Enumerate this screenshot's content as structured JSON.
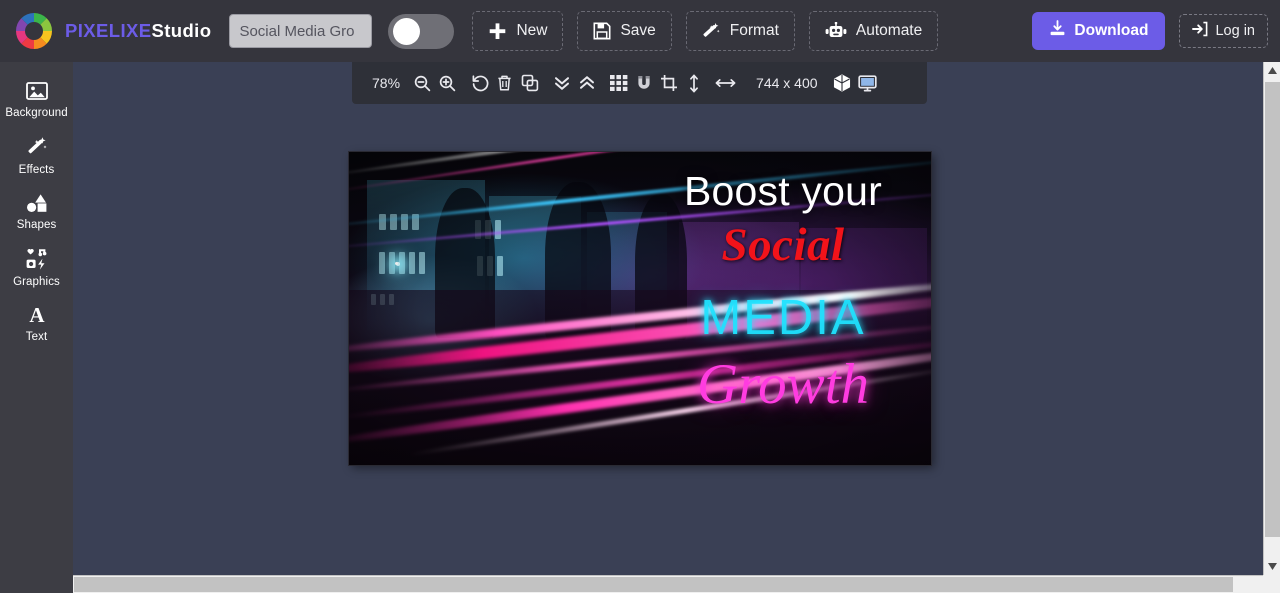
{
  "app": {
    "brand_primary": "PIXELIXE",
    "brand_secondary": "Studio",
    "accent_color": "#6c5ce7",
    "topbar_bg": "#35353d",
    "sidebar_bg": "#3d3d44",
    "workspace_bg": "#3a4055"
  },
  "header": {
    "project_title_value": "Social Media Gro",
    "project_title_placeholder": "Social Media Gro",
    "toggle_state": "off",
    "buttons": [
      {
        "label": "New",
        "icon": "plus-icon"
      },
      {
        "label": "Save",
        "icon": "floppy-disk-icon"
      },
      {
        "label": "Format",
        "icon": "magic-wand-icon"
      },
      {
        "label": "Automate",
        "icon": "robot-icon"
      }
    ],
    "download_label": "Download",
    "download_icon": "download-icon",
    "login_label": "Log in",
    "login_icon": "sign-in-icon"
  },
  "sidebar": {
    "items": [
      {
        "label": "Background",
        "icon": "image-icon"
      },
      {
        "label": "Effects",
        "icon": "magic-wand-icon"
      },
      {
        "label": "Shapes",
        "icon": "shapes-icon"
      },
      {
        "label": "Graphics",
        "icon": "graphics-grid-icon"
      },
      {
        "label": "Text",
        "icon": "letter-a-icon"
      }
    ]
  },
  "canvas_toolbar": {
    "zoom_level": "78%",
    "dimensions": "744 x 400",
    "icons": [
      "zoom-out-icon",
      "zoom-in-icon",
      "undo-icon",
      "trash-icon",
      "duplicate-icon",
      "send-backward-icon",
      "bring-forward-icon",
      "grid-icon",
      "magnet-snap-icon",
      "crop-icon",
      "resize-vertical-icon",
      "resize-horizontal-icon",
      "cube-3d-icon",
      "monitor-preview-icon"
    ]
  },
  "canvas": {
    "design_title_line1": "Boost your",
    "design_title_line2": "Social",
    "design_title_line3": "MEDIA",
    "design_title_line4": "Growth",
    "color_line1": "#ffffff",
    "color_line2": "#f2131a",
    "color_line3": "#1fe3ff",
    "color_line4": "#ff3ce0"
  },
  "scrollbars": {
    "vertical_position": "near-top",
    "horizontal_position": "left"
  }
}
